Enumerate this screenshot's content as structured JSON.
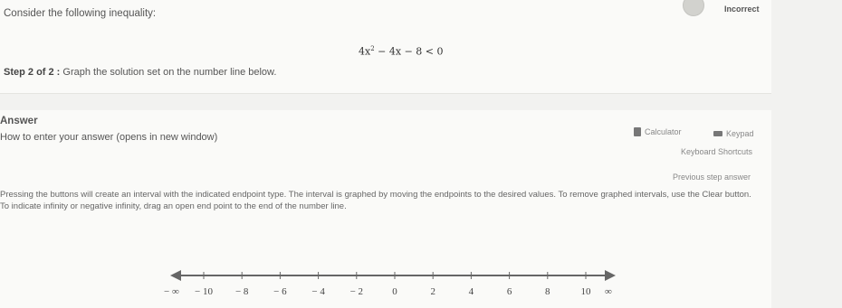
{
  "question": {
    "prompt": "Consider the following inequality:",
    "status": "Incorrect",
    "equation": {
      "a": "4x",
      "exp": "2",
      "rest": " − 4x − 8 < 0"
    },
    "step_label": "Step 2 of 2 :",
    "step_text": " Graph the solution set on the number line below."
  },
  "answer": {
    "heading": "Answer",
    "help_link": "How to enter your answer (opens in new window)",
    "calculator_label": "Calculator",
    "keypad_label": "Keypad",
    "shortcuts_label": "Keyboard Shortcuts",
    "previous_step_label": "Previous step answer",
    "instructions": "Pressing the buttons will create an interval with the indicated endpoint type. The interval is graphed by moving the endpoints to the desired values. To remove graphed intervals, use the Clear button. To indicate infinity or negative infinity, drag an open end point to the end of the number line."
  },
  "number_line": {
    "left_label": "− ∞",
    "right_label": "∞",
    "ticks": [
      {
        "value": -10,
        "label": "− 10"
      },
      {
        "value": -8,
        "label": "− 8"
      },
      {
        "value": -6,
        "label": "− 6"
      },
      {
        "value": -4,
        "label": "− 4"
      },
      {
        "value": -2,
        "label": "− 2"
      },
      {
        "value": 0,
        "label": "0"
      },
      {
        "value": 2,
        "label": "2"
      },
      {
        "value": 4,
        "label": "4"
      },
      {
        "value": 6,
        "label": "6"
      },
      {
        "value": 8,
        "label": "8"
      },
      {
        "value": 10,
        "label": "10"
      }
    ]
  }
}
